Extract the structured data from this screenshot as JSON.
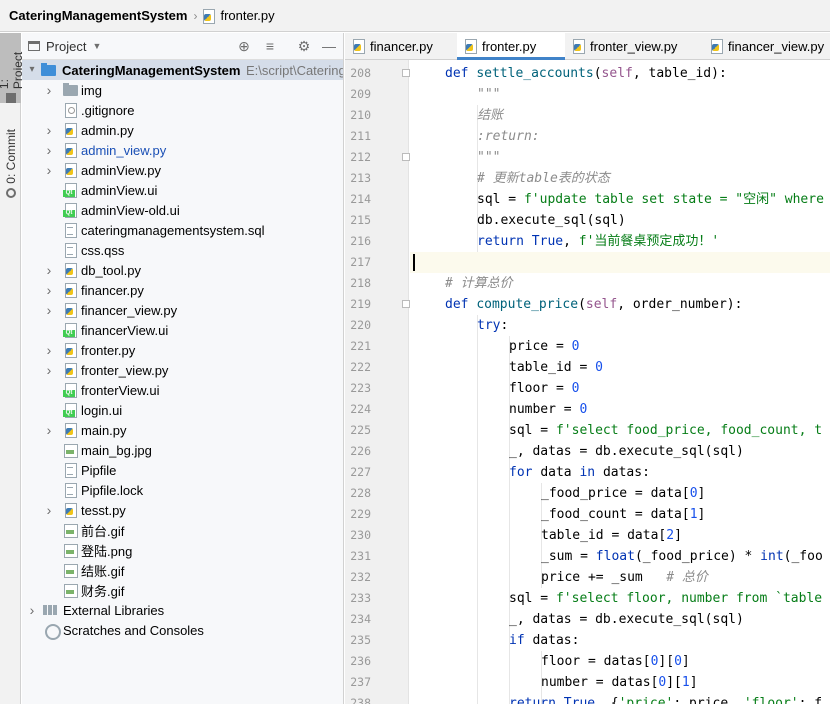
{
  "breadcrumb": {
    "project": "CateringManagementSystem",
    "file": "fronter.py"
  },
  "toolwindows": {
    "project_tab": "1: Project",
    "commit_tab": "0: Commit"
  },
  "project_panel": {
    "title": "Project",
    "root_name": "CateringManagementSystem",
    "root_path": "E:\\script\\CateringManagementSystem",
    "items": [
      {
        "label": "img",
        "type": "folder",
        "expandable": true
      },
      {
        "label": ".gitignore",
        "type": "ignore",
        "expandable": false
      },
      {
        "label": "admin.py",
        "type": "py",
        "expandable": true
      },
      {
        "label": "admin_view.py",
        "type": "py",
        "expandable": true,
        "modified": true
      },
      {
        "label": "adminView.py",
        "type": "py",
        "expandable": true
      },
      {
        "label": "adminView.ui",
        "type": "ui",
        "expandable": false
      },
      {
        "label": "adminView-old.ui",
        "type": "ui",
        "expandable": false
      },
      {
        "label": "cateringmanagementsystem.sql",
        "type": "txt",
        "expandable": false
      },
      {
        "label": "css.qss",
        "type": "txt",
        "expandable": false
      },
      {
        "label": "db_tool.py",
        "type": "py",
        "expandable": true
      },
      {
        "label": "financer.py",
        "type": "py",
        "expandable": true
      },
      {
        "label": "financer_view.py",
        "type": "py",
        "expandable": true
      },
      {
        "label": "financerView.ui",
        "type": "ui",
        "expandable": false
      },
      {
        "label": "fronter.py",
        "type": "py",
        "expandable": true
      },
      {
        "label": "fronter_view.py",
        "type": "py",
        "expandable": true
      },
      {
        "label": "fronterView.ui",
        "type": "ui",
        "expandable": false
      },
      {
        "label": "login.ui",
        "type": "ui",
        "expandable": false
      },
      {
        "label": "main.py",
        "type": "py",
        "expandable": true
      },
      {
        "label": "main_bg.jpg",
        "type": "img",
        "expandable": false
      },
      {
        "label": "Pipfile",
        "type": "txt",
        "expandable": false
      },
      {
        "label": "Pipfile.lock",
        "type": "txt",
        "expandable": false
      },
      {
        "label": "tesst.py",
        "type": "py",
        "expandable": true
      },
      {
        "label": "前台.gif",
        "type": "img",
        "expandable": false
      },
      {
        "label": "登陆.png",
        "type": "img",
        "expandable": false
      },
      {
        "label": "结账.gif",
        "type": "img",
        "expandable": false
      },
      {
        "label": "财务.gif",
        "type": "img",
        "expandable": false
      }
    ],
    "external_libraries": "External Libraries",
    "scratches": "Scratches and Consoles"
  },
  "editor_tabs": [
    {
      "label": "financer.py",
      "active": false
    },
    {
      "label": "fronter.py",
      "active": true
    },
    {
      "label": "fronter_view.py",
      "active": false
    },
    {
      "label": "financer_view.py",
      "active": false
    }
  ],
  "code_lines": [
    {
      "n": "208",
      "indent": 1,
      "tokens": [
        [
          "kw",
          "def "
        ],
        [
          "fn",
          "settle_accounts"
        ],
        [
          "",
          "("
        ],
        [
          "self",
          "self"
        ],
        [
          "",
          ", table_id):"
        ]
      ]
    },
    {
      "n": "209",
      "indent": 2,
      "tokens": [
        [
          "doc",
          "\"\"\""
        ]
      ]
    },
    {
      "n": "210",
      "indent": 2,
      "tokens": [
        [
          "doc",
          "结账"
        ]
      ]
    },
    {
      "n": "211",
      "indent": 2,
      "tokens": [
        [
          "doc",
          ":return:"
        ]
      ]
    },
    {
      "n": "212",
      "indent": 2,
      "tokens": [
        [
          "doc",
          "\"\"\""
        ]
      ]
    },
    {
      "n": "213",
      "indent": 2,
      "tokens": [
        [
          "cmt",
          "# 更新table表的状态"
        ]
      ]
    },
    {
      "n": "214",
      "indent": 2,
      "tokens": [
        [
          "",
          "sql = "
        ],
        [
          "str",
          "f'update table set state = \"空闲\" where"
        ]
      ]
    },
    {
      "n": "215",
      "indent": 2,
      "tokens": [
        [
          "",
          "db.execute_sql(sql)"
        ]
      ]
    },
    {
      "n": "216",
      "indent": 2,
      "tokens": [
        [
          "kw",
          "return "
        ],
        [
          "kw",
          "True"
        ],
        [
          "",
          ", "
        ],
        [
          "str",
          "f'当前餐桌预定成功！'"
        ]
      ]
    },
    {
      "n": "217",
      "indent": 0,
      "tokens": [],
      "current": true
    },
    {
      "n": "218",
      "indent": 1,
      "tokens": [
        [
          "cmt",
          "# 计算总价"
        ]
      ]
    },
    {
      "n": "219",
      "indent": 1,
      "tokens": [
        [
          "kw",
          "def "
        ],
        [
          "fn",
          "compute_price"
        ],
        [
          "",
          "("
        ],
        [
          "self",
          "self"
        ],
        [
          "",
          ", order_number):"
        ]
      ]
    },
    {
      "n": "220",
      "indent": 2,
      "tokens": [
        [
          "kw",
          "try"
        ],
        [
          "",
          ":"
        ]
      ]
    },
    {
      "n": "221",
      "indent": 3,
      "tokens": [
        [
          "",
          "price = "
        ],
        [
          "num",
          "0"
        ]
      ]
    },
    {
      "n": "222",
      "indent": 3,
      "tokens": [
        [
          "",
          "table_id = "
        ],
        [
          "num",
          "0"
        ]
      ]
    },
    {
      "n": "223",
      "indent": 3,
      "tokens": [
        [
          "",
          "floor = "
        ],
        [
          "num",
          "0"
        ]
      ]
    },
    {
      "n": "224",
      "indent": 3,
      "tokens": [
        [
          "",
          "number = "
        ],
        [
          "num",
          "0"
        ]
      ]
    },
    {
      "n": "225",
      "indent": 3,
      "tokens": [
        [
          "",
          "sql = "
        ],
        [
          "str",
          "f'select food_price, food_count, t"
        ]
      ]
    },
    {
      "n": "226",
      "indent": 3,
      "tokens": [
        [
          "",
          "_, datas = db.execute_sql(sql)"
        ]
      ]
    },
    {
      "n": "227",
      "indent": 3,
      "tokens": [
        [
          "kw",
          "for "
        ],
        [
          "",
          "data "
        ],
        [
          "kw",
          "in "
        ],
        [
          "",
          "datas:"
        ]
      ]
    },
    {
      "n": "228",
      "indent": 4,
      "tokens": [
        [
          "",
          "_food_price = data["
        ],
        [
          "num",
          "0"
        ],
        [
          "",
          "]"
        ]
      ]
    },
    {
      "n": "229",
      "indent": 4,
      "tokens": [
        [
          "",
          "_food_count = data["
        ],
        [
          "num",
          "1"
        ],
        [
          "",
          "]"
        ]
      ]
    },
    {
      "n": "230",
      "indent": 4,
      "tokens": [
        [
          "",
          "table_id = data["
        ],
        [
          "num",
          "2"
        ],
        [
          "",
          "]"
        ]
      ]
    },
    {
      "n": "231",
      "indent": 4,
      "tokens": [
        [
          "",
          "_sum = "
        ],
        [
          "kw",
          "float"
        ],
        [
          "",
          "(_food_price) * "
        ],
        [
          "kw",
          "int"
        ],
        [
          "",
          "(_foo"
        ]
      ]
    },
    {
      "n": "232",
      "indent": 4,
      "tokens": [
        [
          "",
          "price += _sum   "
        ],
        [
          "cmt",
          "# 总价"
        ]
      ]
    },
    {
      "n": "233",
      "indent": 3,
      "tokens": [
        [
          "",
          "sql = "
        ],
        [
          "str",
          "f'select floor, number from `table"
        ]
      ]
    },
    {
      "n": "234",
      "indent": 3,
      "tokens": [
        [
          "",
          "_, datas = db.execute_sql(sql)"
        ]
      ]
    },
    {
      "n": "235",
      "indent": 3,
      "tokens": [
        [
          "kw",
          "if "
        ],
        [
          "",
          "datas:"
        ]
      ]
    },
    {
      "n": "236",
      "indent": 4,
      "tokens": [
        [
          "",
          "floor = datas["
        ],
        [
          "num",
          "0"
        ],
        [
          "",
          "]["
        ],
        [
          "num",
          "0"
        ],
        [
          "",
          "]"
        ]
      ]
    },
    {
      "n": "237",
      "indent": 4,
      "tokens": [
        [
          "",
          "number = datas["
        ],
        [
          "num",
          "0"
        ],
        [
          "",
          "]["
        ],
        [
          "num",
          "1"
        ],
        [
          "",
          "]"
        ]
      ]
    },
    {
      "n": "238",
      "indent": 3,
      "tokens": [
        [
          "kw",
          "return "
        ],
        [
          "kw",
          "True"
        ],
        [
          "",
          ", {"
        ],
        [
          "str",
          "'price'"
        ],
        [
          "",
          ": price, "
        ],
        [
          "str",
          "'floor'"
        ],
        [
          "",
          ": f"
        ]
      ]
    }
  ]
}
